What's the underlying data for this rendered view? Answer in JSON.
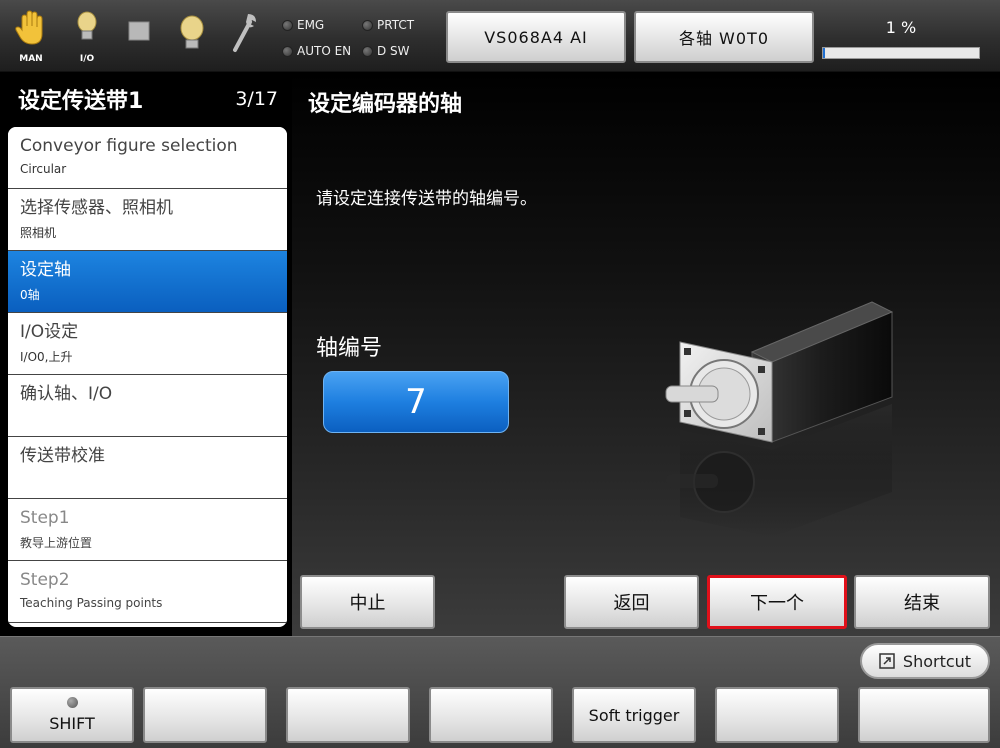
{
  "topbar": {
    "mode_icons": [
      {
        "icon": "hand-icon",
        "caption": "MAN",
        "color": "#f2c23a"
      },
      {
        "icon": "bulb-icon",
        "caption": "I/O",
        "color": "#e9d48a"
      },
      {
        "icon": "stop-square-icon",
        "caption": "",
        "color": "#b8b8b8"
      },
      {
        "icon": "bulb-icon",
        "caption": "",
        "color": "#e9d48a"
      },
      {
        "icon": "wrench-icon",
        "caption": "",
        "color": "#bfbfbf"
      }
    ],
    "leds": {
      "emg": "EMG",
      "prtct": "PRTCT",
      "auto_en": "AUTO EN",
      "dsw": "D SW"
    },
    "robot_button": "VS068A4 AI",
    "axis_button": "各轴 W0T0",
    "progress": {
      "label": "1 %",
      "value_percent": 1,
      "fill_color": "#1f6fd1"
    }
  },
  "left_panel": {
    "title": "设定传送带1",
    "counter": "3/17",
    "steps": [
      {
        "main": "Conveyor figure selection",
        "sub": "Circular",
        "state": "normal"
      },
      {
        "main": "选择传感器、照相机",
        "sub": "照相机",
        "state": "normal"
      },
      {
        "main": "设定轴",
        "sub": "0轴",
        "state": "active"
      },
      {
        "main": "I/O设定",
        "sub": "I/O0,上升",
        "state": "normal"
      },
      {
        "main": "确认轴、I/O",
        "sub": "",
        "state": "normal"
      },
      {
        "main": "传送带校准",
        "sub": "",
        "state": "normal"
      },
      {
        "main": "Step1",
        "sub": "教导上游位置",
        "state": "dim"
      },
      {
        "main": "Step2",
        "sub": "Teaching Passing points",
        "state": "dim"
      }
    ]
  },
  "main": {
    "title": "设定编码器的轴",
    "instruction": "请设定连接传送带的轴编号。",
    "axis_label": "轴编号",
    "axis_value": "7",
    "buttons": {
      "abort": "中止",
      "back": "返回",
      "next": "下一个",
      "finish": "结束"
    },
    "highlight_color": "#e0101a"
  },
  "bottom": {
    "shortcut": "Shortcut",
    "function_keys": [
      "SHIFT",
      "",
      "",
      "",
      "Soft trigger",
      "",
      ""
    ]
  }
}
